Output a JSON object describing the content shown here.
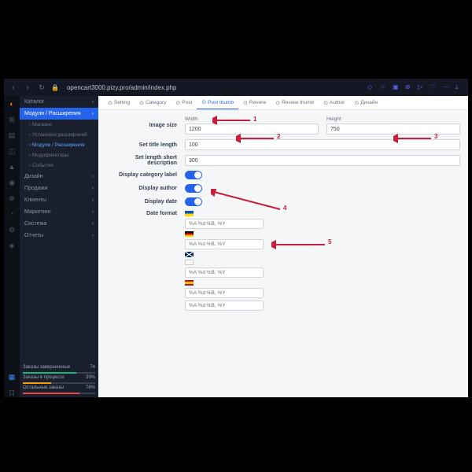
{
  "url": "opencart3000.pizy.pro/admin/index.php",
  "sidebar": {
    "items": [
      {
        "label": "Каталог",
        "type": "head"
      },
      {
        "label": "Модули / Расширения",
        "type": "selected"
      },
      {
        "label": "Магазин",
        "type": "sub"
      },
      {
        "label": "Установка расширений",
        "type": "sub"
      },
      {
        "label": "Модули / Расширения",
        "type": "sub",
        "active": true
      },
      {
        "label": "Модификаторы",
        "type": "sub"
      },
      {
        "label": "События",
        "type": "sub"
      },
      {
        "label": "Дизайн",
        "type": "head"
      },
      {
        "label": "Продажи",
        "type": "head"
      },
      {
        "label": "Клиенты",
        "type": "head"
      },
      {
        "label": "Маркетинг",
        "type": "head"
      },
      {
        "label": "Система",
        "type": "head"
      },
      {
        "label": "Отчеты",
        "type": "head"
      }
    ],
    "stats": [
      {
        "label": "Заказы завершенные",
        "val": "74"
      },
      {
        "label": "Заказы в процессе",
        "val": "39%"
      },
      {
        "label": "Остальные заказы",
        "val": "78%"
      }
    ]
  },
  "tabs": [
    {
      "label": "Setting"
    },
    {
      "label": "Category"
    },
    {
      "label": "Post"
    },
    {
      "label": "Post thumb",
      "active": true
    },
    {
      "label": "Review"
    },
    {
      "label": "Review thumb"
    },
    {
      "label": "Author"
    },
    {
      "label": "Дизайн"
    }
  ],
  "form": {
    "imageSize": {
      "label": "Image size",
      "widthLabel": "Width",
      "width": "1200",
      "heightLabel": "Height",
      "height": "750"
    },
    "titleLen": {
      "label": "Set title length",
      "val": "100"
    },
    "shortDesc": {
      "label": "Set length short description",
      "val": "300"
    },
    "catLabel": {
      "label": "Display category label"
    },
    "author": {
      "label": "Display author"
    },
    "date": {
      "label": "Display date"
    },
    "dateFmt": {
      "label": "Date format",
      "val": "%A %d %B, %Y"
    }
  },
  "annotations": [
    "1",
    "2",
    "3",
    "4",
    "5"
  ]
}
